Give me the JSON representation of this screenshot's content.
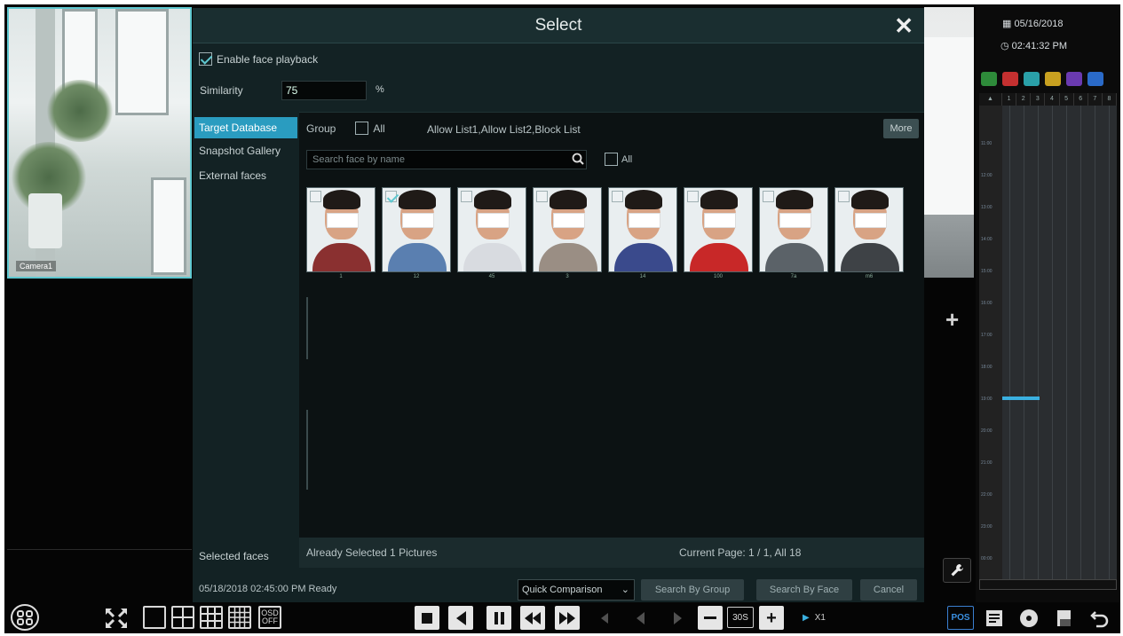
{
  "left_camera": {
    "label": "Camera1"
  },
  "dialog": {
    "title": "Select",
    "enable_face_playback": {
      "label": "Enable face playback",
      "checked": true
    },
    "similarity": {
      "label": "Similarity",
      "value": "75",
      "unit": "%"
    },
    "sidebar": {
      "items": [
        {
          "label": "Target Database",
          "active": true
        },
        {
          "label": "Snapshot Gallery",
          "active": false
        },
        {
          "label": "External faces",
          "active": false
        }
      ],
      "selected_faces_label": "Selected faces"
    },
    "group": {
      "label": "Group",
      "all_label": "All",
      "groups_text": "Allow List1,Allow List2,Block List",
      "more_label": "More"
    },
    "search": {
      "placeholder": "Search face by name",
      "all_label": "All"
    },
    "faces": [
      {
        "name": "1",
        "checked": false,
        "shirt": "#8a3030"
      },
      {
        "name": "12",
        "checked": true,
        "shirt": "#5a7fb0"
      },
      {
        "name": "45",
        "checked": false,
        "shirt": "#d8dbe0"
      },
      {
        "name": "3",
        "checked": false,
        "shirt": "#9a8e84"
      },
      {
        "name": "14",
        "checked": false,
        "shirt": "#3a4a8c"
      },
      {
        "name": "100",
        "checked": false,
        "shirt": "#c82828"
      },
      {
        "name": "7a",
        "checked": false,
        "shirt": "#5b6268"
      },
      {
        "name": "m6",
        "checked": false,
        "shirt": "#3e4246"
      }
    ],
    "status": {
      "already_selected": "Already Selected 1 Pictures",
      "current_page": "Current Page: 1 / 1, All 18"
    },
    "footer": {
      "ready_text": "05/18/2018 02:45:00 PM Ready",
      "compare_select": "Quick Comparison",
      "search_by_group": "Search By Group",
      "search_by_face": "Search By Face",
      "cancel": "Cancel"
    }
  },
  "timeline": {
    "date": "05/16/2018",
    "time": "02:41:32 PM",
    "channels": [
      "1",
      "2",
      "3",
      "4",
      "5",
      "6",
      "7",
      "8"
    ],
    "ticks": [
      "11:00",
      "12:00",
      "13:00",
      "14:00",
      "15:00",
      "16:00",
      "17:00",
      "18:00",
      "19:00",
      "20:00",
      "21:00",
      "22:00",
      "23:00",
      "00:00"
    ],
    "icon_colors": [
      "#2e8b3a",
      "#c43030",
      "#2aa0a8",
      "#c8a020",
      "#6a3ab0",
      "#2a6ac8"
    ]
  },
  "toolbar": {
    "osd_label": "OSD\nOFF",
    "speed_value": "30S",
    "speed_multiplier": "X1",
    "pos_label": "POS"
  }
}
